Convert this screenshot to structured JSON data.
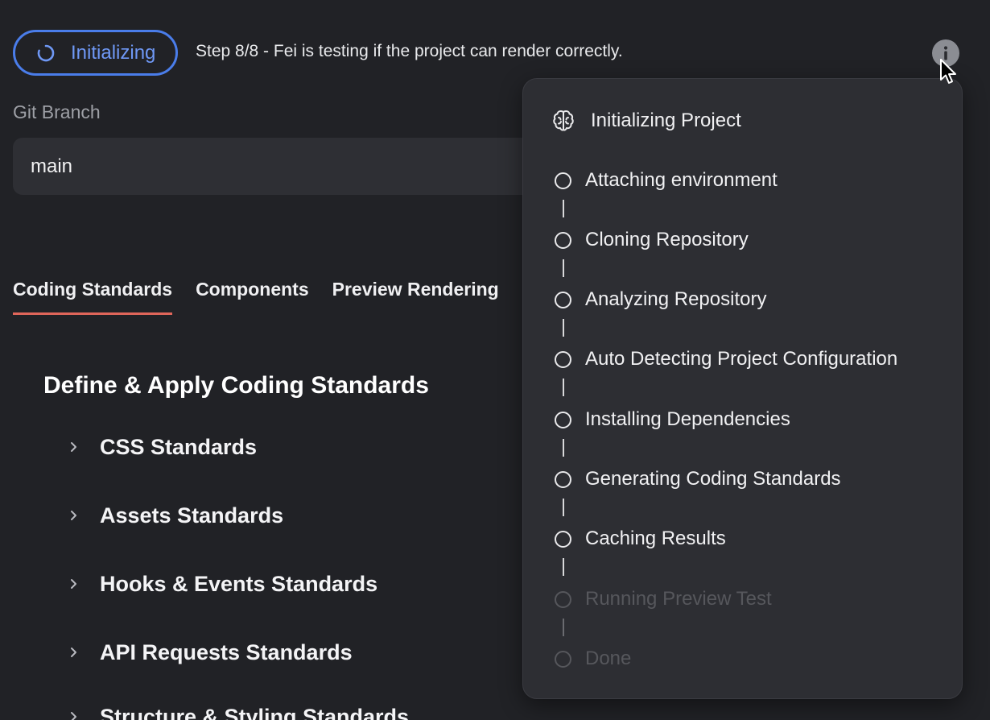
{
  "status": {
    "label": "Initializing",
    "step_text": "Step 8/8 - Fei is testing if the project can render correctly.",
    "accent_color": "#4a7dea"
  },
  "git": {
    "label": "Git Branch",
    "branch_value": "main"
  },
  "tabs": [
    {
      "label": "Coding Standards",
      "active": true
    },
    {
      "label": "Components",
      "active": false
    },
    {
      "label": "Preview Rendering",
      "active": false
    }
  ],
  "section": {
    "title": "Define & Apply Coding Standards",
    "items": [
      {
        "label": "CSS Standards"
      },
      {
        "label": "Assets Standards"
      },
      {
        "label": "Hooks & Events Standards"
      },
      {
        "label": "API Requests Standards"
      },
      {
        "label": "Structure & Styling Standards"
      }
    ]
  },
  "popover": {
    "title": "Initializing Project",
    "icon": "brain-icon",
    "steps": [
      {
        "label": "Attaching environment",
        "state": "active"
      },
      {
        "label": "Cloning Repository",
        "state": "active"
      },
      {
        "label": "Analyzing Repository",
        "state": "active"
      },
      {
        "label": "Auto Detecting Project Configuration",
        "state": "active"
      },
      {
        "label": "Installing Dependencies",
        "state": "active"
      },
      {
        "label": "Generating Coding Standards",
        "state": "active"
      },
      {
        "label": "Caching Results",
        "state": "active"
      },
      {
        "label": "Running Preview Test",
        "state": "pending"
      },
      {
        "label": "Done",
        "state": "pending"
      }
    ]
  }
}
